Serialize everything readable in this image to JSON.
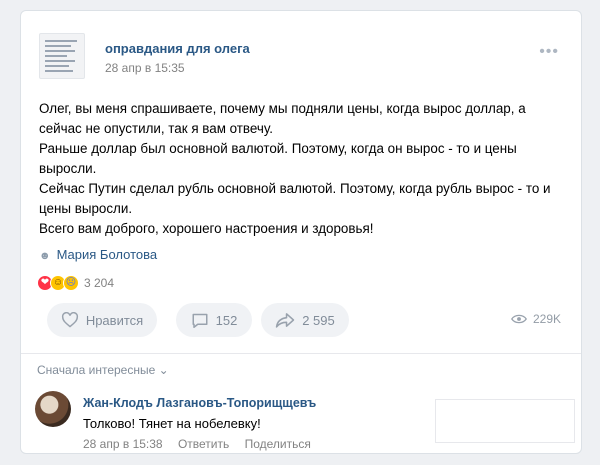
{
  "post": {
    "group_name": "оправдания для олега",
    "date": "28 апр в 15:35",
    "text_lines": [
      "Олег, вы меня спрашиваете, почему мы подняли цены, когда вырос доллар, а",
      "сейчас не опустили, так я вам отвечу.",
      "Раньше доллар был основной валютой. Поэтому, когда он вырос - то и цены",
      "выросли.",
      "Сейчас Путин сделал рубль основной валютой. Поэтому, когда рубль вырос - то и",
      "цены выросли.",
      "Всего вам доброго, хорошего настроения и здоровья!"
    ],
    "author": "Мария Болотова",
    "reactions_count": "3 204",
    "like_label": "Нравится",
    "comments_count": "152",
    "shares_count": "2 595",
    "views_count": "229K"
  },
  "comments_section": {
    "sort_label": "Сначала интересные",
    "comments": [
      {
        "author": "Жан-Клодъ Лазгановъ-Топорищщевъ",
        "text": "Толково! Тянет на нобелевку!",
        "date": "28 апр в 15:38",
        "reply_label": "Ответить",
        "share_label": "Поделиться"
      }
    ]
  },
  "icons": {
    "more": "more-icon",
    "person": "person-icon",
    "heart": "heart-icon",
    "comment": "comment-icon",
    "share": "share-icon",
    "views": "eye-icon",
    "chevron": "chevron-down-icon"
  },
  "colors": {
    "link": "#2a5885",
    "secondary_text": "#828282",
    "button_bg": "#f0f2f5",
    "reaction_heart": "#ff3347",
    "reaction_emoji": "#ffc400"
  }
}
